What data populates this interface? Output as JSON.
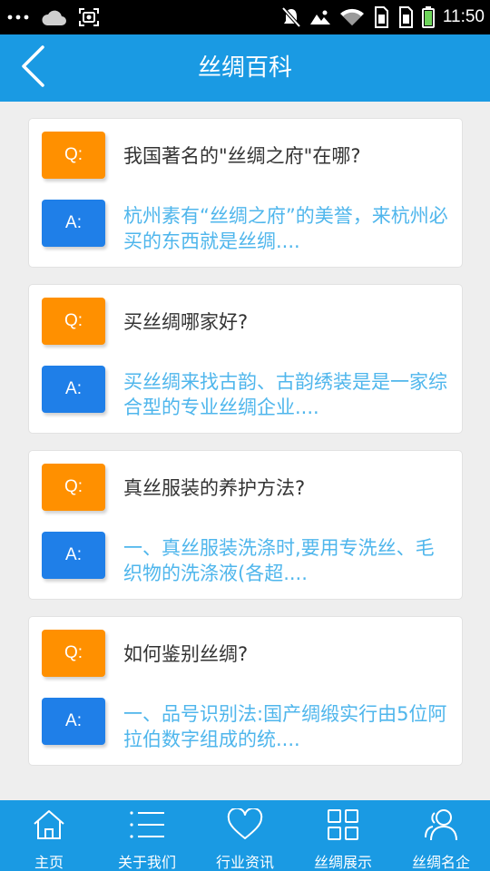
{
  "status_bar": {
    "time": "11:50",
    "left_icons": [
      "more-dots-icon",
      "cloud-icon",
      "screenshot-icon"
    ],
    "right_icons": [
      "mute-icon",
      "photo-icon",
      "wifi-icon",
      "sim1-icon",
      "sim2-icon",
      "battery-icon"
    ]
  },
  "header": {
    "title": "丝绸百科",
    "back_icon": "chevron-left-icon"
  },
  "faq": [
    {
      "q_label": "Q:",
      "a_label": "A:",
      "question": "我国著名的\"丝绸之府\"在哪?",
      "answer": "杭州素有“丝绸之府”的美誉，来杭州必买的东西就是丝绸...."
    },
    {
      "q_label": "Q:",
      "a_label": "A:",
      "question": "买丝绸哪家好?",
      "answer": "买丝绸来找古韵、古韵绣装是是一家综合型的专业丝绸企业...."
    },
    {
      "q_label": "Q:",
      "a_label": "A:",
      "question": "真丝服装的养护方法?",
      "answer": "一、真丝服装洗涤时,要用专洗丝、毛织物的洗涤液(各超...."
    },
    {
      "q_label": "Q:",
      "a_label": "A:",
      "question": "如何鉴别丝绸?",
      "answer": "一、品号识别法:国产绸缎实行由5位阿拉伯数字组成的统...."
    }
  ],
  "bottom_nav": [
    {
      "label": "主页",
      "icon": "home-icon"
    },
    {
      "label": "关于我们",
      "icon": "list-icon"
    },
    {
      "label": "行业资讯",
      "icon": "heart-icon"
    },
    {
      "label": "丝绸展示",
      "icon": "grid-icon"
    },
    {
      "label": "丝绸名企",
      "icon": "users-icon"
    }
  ],
  "colors": {
    "header_bg": "#1a9ae3",
    "question_badge": "#ff9000",
    "answer_badge": "#1f7fe8",
    "answer_text": "#4fb6ec",
    "question_text": "#333333",
    "page_bg": "#eeeeee"
  }
}
